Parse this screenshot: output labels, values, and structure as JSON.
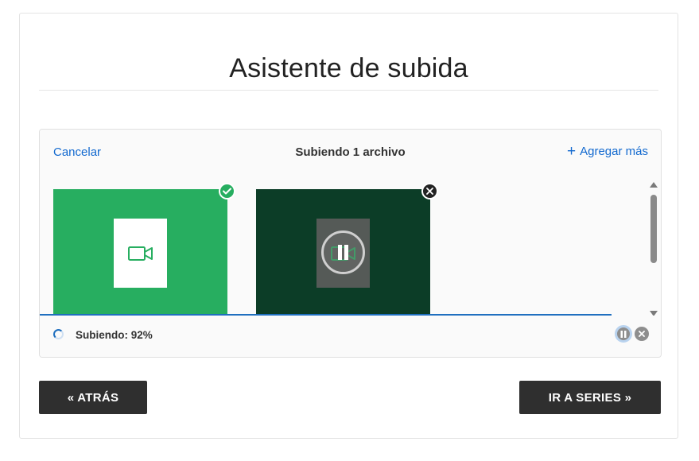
{
  "page": {
    "title": "Asistente de subida"
  },
  "uploader": {
    "cancel_label": "Cancelar",
    "header_title": "Subiendo 1 archivo",
    "add_more_label": "Agregar más",
    "status_text": "Subiendo: 92%",
    "progress_percent": 92,
    "files": [
      {
        "state": "complete",
        "icon": "video-camera-icon",
        "badge": "check-icon",
        "bg_color": "#27ae60"
      },
      {
        "state": "paused",
        "icon": "video-camera-icon",
        "badge": "close-icon",
        "bg_color": "#0c3d27"
      }
    ]
  },
  "actions": {
    "back_label": "« ATRÁS",
    "next_label": "IR A SERIES »"
  },
  "colors": {
    "accent": "#1269cf",
    "success": "#27ae60",
    "button_dark": "#2f2f2f"
  }
}
